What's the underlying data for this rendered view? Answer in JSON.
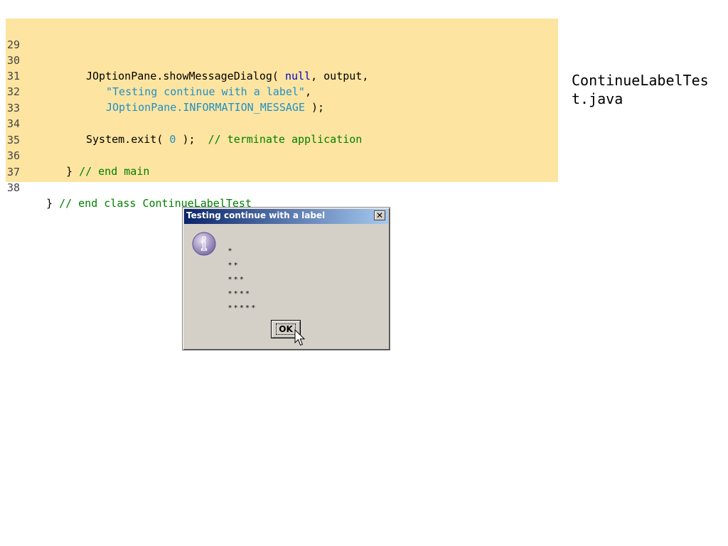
{
  "code": {
    "lines": [
      {
        "n": "29"
      },
      {
        "n": "30",
        "a": "JOptionPane.showMessageDialog( ",
        "kw": "null",
        "b": ", output,"
      },
      {
        "n": "31",
        "str": "\"Testing continue with a label\"",
        "b": ","
      },
      {
        "n": "32",
        "str": "JOptionPane.INFORMATION_MESSAGE",
        "b": " );"
      },
      {
        "n": "33"
      },
      {
        "n": "34",
        "a": "System.exit( ",
        "num": "0",
        "b": " );  ",
        "cm": "// terminate application"
      },
      {
        "n": "35"
      },
      {
        "n": "36",
        "a": "} ",
        "cm": "// end main"
      },
      {
        "n": "37"
      },
      {
        "n": "38",
        "a": "} ",
        "cm": "// end class ContinueLabelTest"
      }
    ]
  },
  "filename": "ContinueLabelTest.java",
  "dialog": {
    "title": "Testing continue with a label",
    "close_label": "✕",
    "output_lines": [
      "*",
      "* *",
      "* * *",
      "* * * *",
      "* * * * *"
    ],
    "ok_label": "OK",
    "icon": "information-icon"
  },
  "colors": {
    "code_background": "#fde4a0",
    "keyword": "#0000cc",
    "string": "#1e90c8",
    "comment": "#008000",
    "titlebar_start": "#0a246a",
    "titlebar_end": "#a6caf0",
    "dialog_background": "#d4d0c8"
  }
}
